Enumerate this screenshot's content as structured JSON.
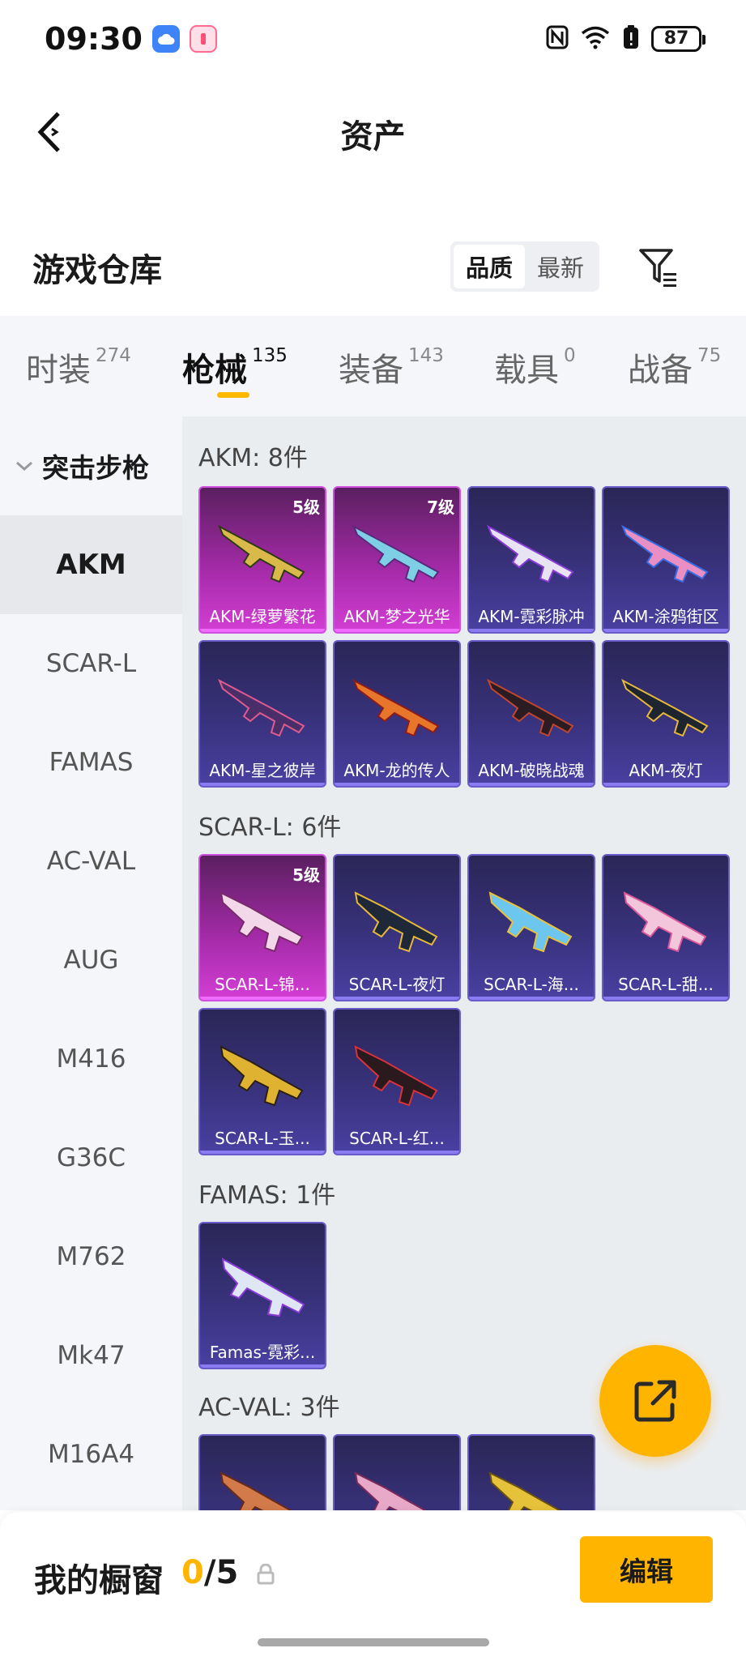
{
  "status_bar": {
    "time": "09:30",
    "battery": "87",
    "icons": [
      "cloud-app-icon",
      "pink-app-icon",
      "nfc-icon",
      "wifi-icon",
      "battery-alert-icon",
      "battery-icon"
    ]
  },
  "header": {
    "title": "资产",
    "back_icon": "back-arrow-icon"
  },
  "warehouse": {
    "title": "游戏仓库",
    "sort_options": [
      "品质",
      "最新"
    ],
    "sort_selected": "品质",
    "filter_icon": "filter-icon"
  },
  "tabs": [
    {
      "label": "时装",
      "count": "274"
    },
    {
      "label": "枪械",
      "count": "135"
    },
    {
      "label": "装备",
      "count": "143"
    },
    {
      "label": "载具",
      "count": "0"
    },
    {
      "label": "战备",
      "count": "75"
    }
  ],
  "active_tab": "枪械",
  "sidebar": {
    "group": "突击步枪",
    "items": [
      "AKM",
      "SCAR-L",
      "FAMAS",
      "AC-VAL",
      "AUG",
      "M416",
      "G36C",
      "M762",
      "Mk47",
      "M16A4"
    ],
    "active": "AKM"
  },
  "sections": [
    {
      "title": "AKM: 8件",
      "items": [
        {
          "name": "AKM-绿萝繁花",
          "level": "5级",
          "quality": "q5"
        },
        {
          "name": "AKM-梦之光华",
          "level": "7级",
          "quality": "q5"
        },
        {
          "name": "AKM-霓彩脉冲",
          "level": "",
          "quality": "q4"
        },
        {
          "name": "AKM-涂鸦街区",
          "level": "",
          "quality": "q4"
        },
        {
          "name": "AKM-星之彼岸",
          "level": "",
          "quality": "q4"
        },
        {
          "name": "AKM-龙的传人",
          "level": "",
          "quality": "q4"
        },
        {
          "name": "AKM-破晓战魂",
          "level": "",
          "quality": "q4"
        },
        {
          "name": "AKM-夜灯",
          "level": "",
          "quality": "q4"
        }
      ]
    },
    {
      "title": "SCAR-L: 6件",
      "items": [
        {
          "name": "SCAR-L-锦...",
          "level": "5级",
          "quality": "q5"
        },
        {
          "name": "SCAR-L-夜灯",
          "level": "",
          "quality": "q4"
        },
        {
          "name": "SCAR-L-海...",
          "level": "",
          "quality": "q4"
        },
        {
          "name": "SCAR-L-甜...",
          "level": "",
          "quality": "q4"
        },
        {
          "name": "SCAR-L-玉...",
          "level": "",
          "quality": "q4"
        },
        {
          "name": "SCAR-L-红...",
          "level": "",
          "quality": "q4"
        }
      ]
    },
    {
      "title": "FAMAS: 1件",
      "items": [
        {
          "name": "Famas-霓彩...",
          "level": "",
          "quality": "q4"
        }
      ]
    },
    {
      "title": "AC-VAL: 3件",
      "items": [
        {
          "name": "",
          "level": "",
          "quality": "q4"
        },
        {
          "name": "",
          "level": "",
          "quality": "q4"
        },
        {
          "name": "",
          "level": "",
          "quality": "q4"
        }
      ]
    }
  ],
  "fab_icon": "share-icon",
  "bottom_bar": {
    "showcase_label": "我的橱窗",
    "showcase_current": "0",
    "showcase_total": "/5",
    "lock_icon": "lock-icon",
    "edit_label": "编辑"
  },
  "colors": {
    "accent": "#ffb400",
    "quality_purple": "#3a3380",
    "quality_pink": "#d33ed4"
  }
}
